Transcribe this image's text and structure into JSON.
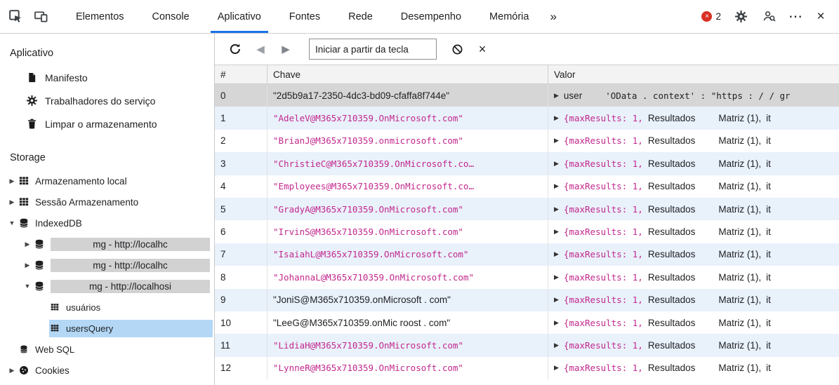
{
  "colors": {
    "accent": "#1a73e8",
    "string": "#c2278d",
    "stripe": "#e9f1fb",
    "selected_row": "#d6d6d6",
    "tree_selected": "#b3d7f5",
    "badge": "#d2d2d2",
    "error": "#d93025"
  },
  "topbar": {
    "tabs": [
      {
        "label": "Elementos",
        "active": false
      },
      {
        "label": "Console",
        "active": false
      },
      {
        "label": "Aplicativo",
        "active": true
      },
      {
        "label": "Fontes",
        "active": false
      },
      {
        "label": "Rede",
        "active": false
      },
      {
        "label": "Desempenho",
        "active": false
      },
      {
        "label": "Memória",
        "active": false
      }
    ],
    "more_tabs": "»",
    "error_count": "2",
    "error_glyph": "×",
    "more_options": "⋯",
    "close": "×"
  },
  "sidebar": {
    "title": "Aplicativo",
    "items": [
      {
        "label": "Manifesto",
        "icon": "document"
      },
      {
        "label": "Trabalhadores do serviço",
        "icon": "gear"
      },
      {
        "label": "Limpar o armazenamento",
        "icon": "trash"
      }
    ],
    "storage_title": "Storage",
    "tree": [
      {
        "label": "Armazenamento local",
        "icon": "grid",
        "arrow": "right",
        "depth": 0
      },
      {
        "label": "Sessão Armazenamento",
        "icon": "grid",
        "arrow": "right",
        "depth": 0
      },
      {
        "label": "IndexedDB",
        "icon": "db",
        "arrow": "down",
        "depth": 0
      },
      {
        "label": "mg - http://localhc",
        "icon": "db",
        "arrow": "right",
        "depth": 1,
        "badge": true
      },
      {
        "label": "mg - http://localhc",
        "icon": "db",
        "arrow": "right",
        "depth": 1,
        "badge": true
      },
      {
        "label": "mg - http://localhosi",
        "icon": "db",
        "arrow": "down",
        "depth": 1,
        "badge": true
      },
      {
        "label": "usuários",
        "icon": "grid",
        "arrow": "none",
        "depth": 2,
        "small": true
      },
      {
        "label": "usersQuery",
        "icon": "grid",
        "arrow": "none",
        "depth": 2,
        "small": true,
        "selected": true
      },
      {
        "label": "Web SQL",
        "icon": "db",
        "arrow": "none",
        "depth": 0,
        "small": true
      },
      {
        "label": "Cookies",
        "icon": "cookie",
        "arrow": "right",
        "depth": 0
      }
    ]
  },
  "main": {
    "toolbar": {
      "key_input": "Iniciar a partir da tecla",
      "back_icon": "◀",
      "forward_icon": "▶",
      "clear_icon": "×"
    },
    "table": {
      "columns": [
        "#",
        "Chave",
        "Valor"
      ],
      "expand_icon": "▶",
      "common_value_segments": [
        {
          "text": "{maxResults: 1,",
          "style": "magenta"
        },
        {
          "text": "Resultados",
          "style": "plain"
        },
        {
          "text": "Matriz (1),",
          "style": "plain",
          "gap": true
        },
        {
          "text": "it",
          "style": "plain"
        }
      ],
      "rows": [
        {
          "index": "0",
          "key": "\"2d5b9a17-2350-4dc3-bd09-cfaffa8f744e\"",
          "key_style": "plain",
          "selected": true,
          "value_segments": [
            {
              "text": "user",
              "style": "plain"
            },
            {
              "text": "'OData . context' : \"https : / / gr",
              "style": "mono",
              "gap": true
            }
          ]
        },
        {
          "index": "1",
          "key": "\"AdeleV@M365x710359.OnMicrosoft.com\"",
          "key_style": "string",
          "value_segments": "common"
        },
        {
          "index": "2",
          "key": "\"BrianJ@M365x710359.onmicrosoft.com\"",
          "key_style": "string",
          "value_segments": "common"
        },
        {
          "index": "3",
          "key": "\"ChristieC@M365x710359.OnMicrosoft.co…",
          "key_style": "string",
          "value_segments": "common"
        },
        {
          "index": "4",
          "key": "\"Employees@M365x710359.OnMicrosoft.co…",
          "key_style": "string",
          "value_segments": "common"
        },
        {
          "index": "5",
          "key": "\"GradyA@M365x710359.OnMicrosoft.com\"",
          "key_style": "string",
          "value_segments": "common"
        },
        {
          "index": "6",
          "key": "\"IrvinS@M365x710359.OnMicrosoft.com\"",
          "key_style": "string",
          "value_segments": "common"
        },
        {
          "index": "7",
          "key": "\"IsaiahL@M365x710359.OnMicrosoft.com\"",
          "key_style": "string",
          "value_segments": "common"
        },
        {
          "index": "8",
          "key": "\"JohannaL@M365x710359.OnMicrosoft.com\"",
          "key_style": "string",
          "value_segments": "common"
        },
        {
          "index": "9",
          "key": "\"JoniS@M365x710359.onMicrosoft . com\"",
          "key_style": "plain",
          "value_segments": "common"
        },
        {
          "index": "10",
          "key": "\"LeeG@M365x710359.onMic roost . com\"",
          "key_style": "plain",
          "value_segments": "common"
        },
        {
          "index": "11",
          "key": "\"LidiaH@M365x710359.OnMicrosoft.com\"",
          "key_style": "string",
          "value_segments": "common"
        },
        {
          "index": "12",
          "key": "\"LynneR@M365x710359.OnMicrosoft.com\"",
          "key_style": "string",
          "value_segments": "common"
        }
      ]
    }
  }
}
